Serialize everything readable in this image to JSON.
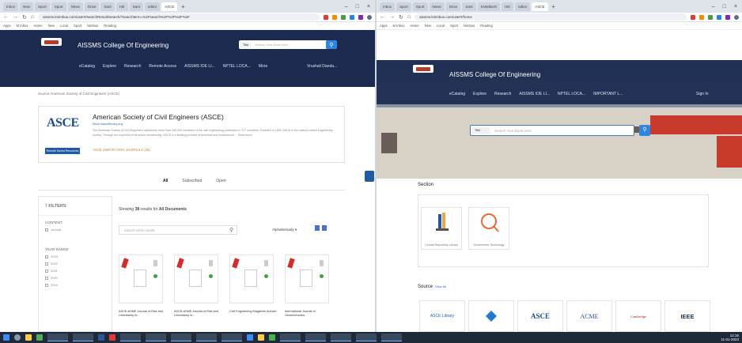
{
  "left": {
    "tabs": [
      "Inbox",
      "New",
      "Sport",
      "Sport",
      "News",
      "Drive",
      "Sant",
      "Hitr",
      "Sant",
      "editor",
      "ASCE",
      "+"
    ],
    "window_controls": [
      "–",
      "□",
      "×"
    ],
    "url": "aissms.knimbus.com/user#/searchResult/Search/?searchterm=%2Fsearch%2F%2F%2F%2F",
    "bookmarks": [
      "Apps",
      "M Inbox",
      "Home",
      "New",
      "Local",
      "Sport",
      "Nimbus",
      "Reading"
    ],
    "site": {
      "college": "AISSMS College Of Engineering",
      "search_type": "Title",
      "search_placeholder": "Search Your Book Here",
      "menu": [
        "eCatalog",
        "Explore",
        "Research",
        "Remote Access",
        "AISSMS IOE LI...",
        "NPTEL LOCA...",
        "More"
      ],
      "user": "Vrushali Danda..."
    },
    "breadcrumb": "Source   American Society of Civil Engineers (ASCE)",
    "publisher": {
      "logo": "ASCE",
      "name": "American Society of Civil Engineers (ASCE)",
      "url": "https://ascelibrary.org",
      "description": "The American Society of Civil Engineers represents more than 150,000 members of the civil engineering profession in 177 countries. Founded in 1852, ASCE is the nation's oldest engineering society. Through the expertise of its active membership, ASCE is a leading provider of technical and professional ... Read more",
      "button": "Remote Saved Resources",
      "links": "ASCE LIBRARY.ORG   JOURNALS (28)"
    },
    "filters": [
      "All",
      "Subscribed",
      "Open"
    ],
    "sidebar": {
      "header": "FILTERS",
      "content_label": "CONTENT",
      "content_items": [
        "Journal"
      ],
      "year_label": "YEAR RANGE",
      "year_items": [
        "2023",
        "2022",
        "2021",
        "2020",
        "2019"
      ]
    },
    "results_prefix": "Showing ",
    "results_count": "38",
    "results_suffix": " results for ",
    "results_scope": "All Documents",
    "results_search_placeholder": "Search within results",
    "sort": "Alphabetically",
    "docs": [
      "ASCE-ASME Journal of Risk and Uncertainty in...",
      "ASCE-ASME Journal of Risk and Uncertainty in...",
      "Civil Engineering Magazine Archive",
      "International Journal of Geomechanics"
    ]
  },
  "right": {
    "tabs": [
      "Inbox",
      "Sport",
      "Sport",
      "News",
      "Drive",
      "Sant",
      "KNIMBUS",
      "Hitr",
      "editor",
      "ASCE",
      "+"
    ],
    "window_controls": [
      "–",
      "□",
      "×"
    ],
    "url": "aissms.knimbus.com/user#/home",
    "bookmarks": [
      "Apps",
      "M Inbox",
      "Home",
      "New",
      "Local",
      "Sport",
      "Nimbus",
      "Reading"
    ],
    "site": {
      "college": "AISSMS College Of Engineering",
      "menu": [
        "eCatalog",
        "Explore",
        "Research",
        "AISSMS IOE LI...",
        "NPTEL LOCA...",
        "IMPORTANT L..."
      ],
      "signin": "Sign In",
      "search_type": "Title",
      "search_placeholder": "Search Your Book Here"
    },
    "section_title": "Section",
    "section_tiles": [
      "Central Repository Library",
      "Government Technology"
    ],
    "source_title": "Source",
    "source_view": "View All",
    "sources": [
      "ASCE Library",
      "ASME",
      "ASCE",
      "ACME",
      "Cambridge",
      "IEEE"
    ]
  },
  "taskbar": {
    "time": "12:15",
    "date": "11-01-2023"
  }
}
